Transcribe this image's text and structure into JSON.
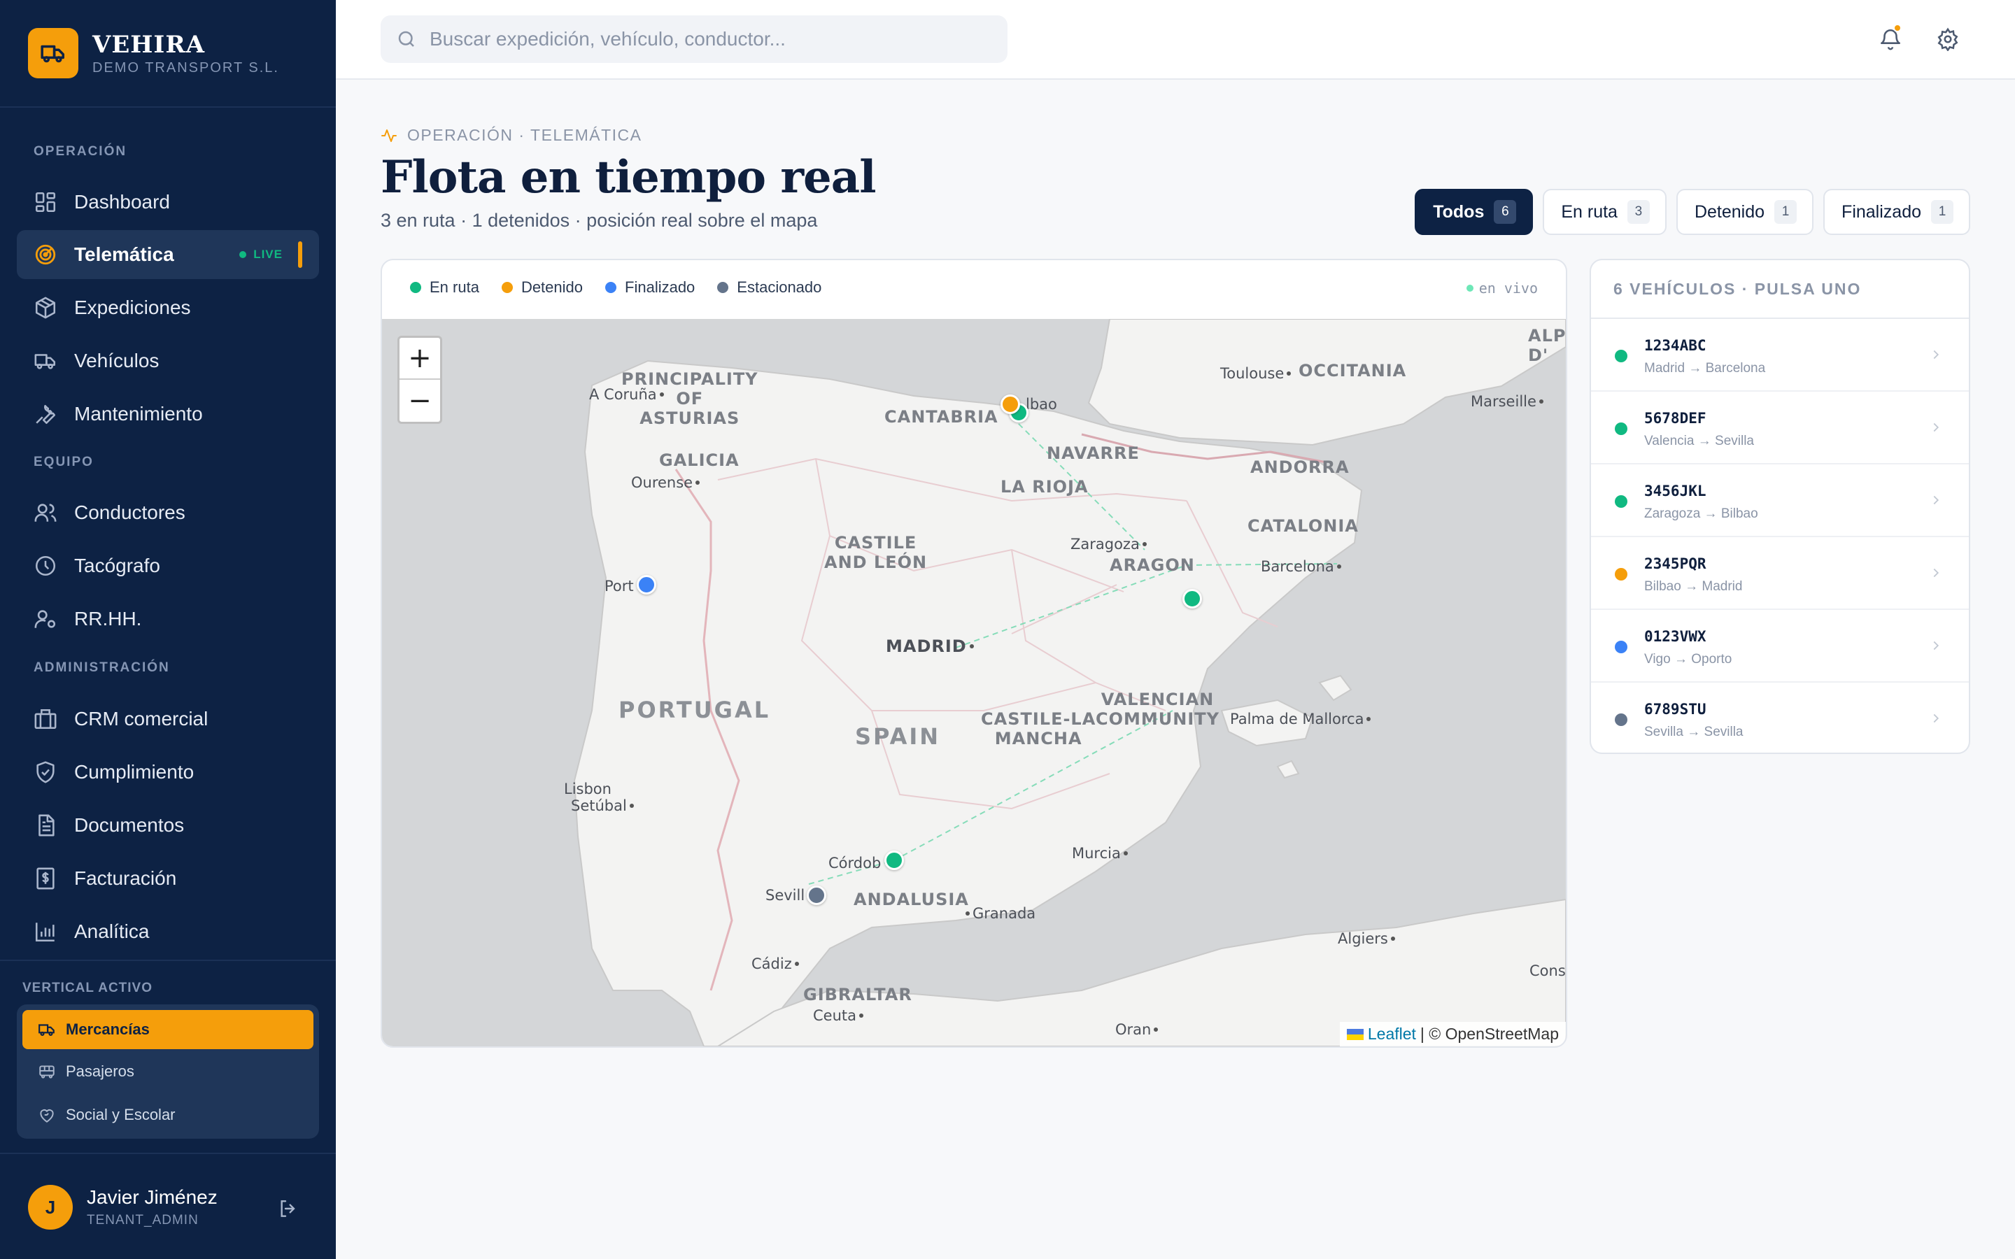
{
  "brand": {
    "name": "VEHIRA",
    "subtitle": "DEMO TRANSPORT S.L."
  },
  "sidebar": {
    "sections": {
      "operacion": "OPERACIÓN",
      "equipo": "EQUIPO",
      "administracion": "ADMINISTRACIÓN"
    },
    "items": {
      "dashboard": "Dashboard",
      "telematica": "Telemática",
      "telematica_badge": "LIVE",
      "expediciones": "Expediciones",
      "vehiculos": "Vehículos",
      "mantenimiento": "Mantenimiento",
      "conductores": "Conductores",
      "tacografo": "Tacógrafo",
      "rrhh": "RR.HH.",
      "crm": "CRM comercial",
      "cumplimiento": "Cumplimiento",
      "documentos": "Documentos",
      "facturacion": "Facturación",
      "analitica": "Analítica"
    },
    "vertical": {
      "label": "VERTICAL ACTIVO",
      "options": [
        "Mercancías",
        "Pasajeros",
        "Social y Escolar"
      ],
      "selected": "Mercancías"
    },
    "user": {
      "initial": "J",
      "name": "Javier Jiménez",
      "role": "TENANT_ADMIN"
    }
  },
  "header": {
    "search_placeholder": "Buscar expedición, vehículo, conductor...",
    "icons": [
      "bell-icon",
      "gear-icon"
    ],
    "has_notification": true
  },
  "page": {
    "eyebrow": "OPERACIÓN · TELEMÁTICA",
    "title": "Flota en tiempo real",
    "subtitle": "3 en ruta · 1 detenidos · posición real sobre el mapa"
  },
  "filters": [
    {
      "label": "Todos",
      "count": "6",
      "active": true
    },
    {
      "label": "En ruta",
      "count": "3"
    },
    {
      "label": "Detenido",
      "count": "1"
    },
    {
      "label": "Finalizado",
      "count": "1"
    }
  ],
  "legend": [
    {
      "label": "En ruta",
      "color": "#10b981"
    },
    {
      "label": "Detenido",
      "color": "#f59e0b"
    },
    {
      "label": "Finalizado",
      "color": "#3b82f6"
    },
    {
      "label": "Estacionado",
      "color": "#64748b"
    }
  ],
  "live_label": "en vivo",
  "map": {
    "zoom_in": "+",
    "zoom_out": "−",
    "attribution_link": "Leaflet",
    "attribution_text": "| © OpenStreetMap",
    "regions": {
      "asturias": "PRINCIPALITY\nOF\nASTURIAS",
      "cantabria": "CANTABRIA",
      "galicia": "GALICIA",
      "navarre": "NAVARRE",
      "rioja": "LA RIOJA",
      "castile_leon": "CASTILE\nAND LEÓN",
      "aragon": "ARAGON",
      "catalonia": "CATALONIA",
      "andorra": "ANDORRA",
      "occitania": "OCCITANIA",
      "alpes": "ALPI\nD'",
      "castile_mancha": "CASTILE-LA\nMANCHA",
      "valencia": "VALENCIAN\nCOMMUNITY",
      "andalusia": "ANDALUSIA",
      "gibraltar": "GIBRALTAR"
    },
    "countries": {
      "portugal": "PORTUGAL",
      "spain": "SPAIN"
    },
    "cities": {
      "acoruna": "A Coruña",
      "ourense": "Ourense",
      "porto": "Port",
      "bilbao": "lbao",
      "toulouse": "Toulouse",
      "marseille": "Marseille",
      "zaragoza": "Zaragoza",
      "barcelona": "Barcelona",
      "madrid": "MADRID",
      "lisbon": "Lisbon",
      "setubal": "Setúbal",
      "palma": "Palma de Mallorca",
      "cordoba": "Córdob",
      "murcia": "Murcia",
      "sevilla": "Sevill",
      "granada": "Granada",
      "cadiz": "Cádiz",
      "ceuta": "Ceuta",
      "algiers": "Algiers",
      "oran": "Oran",
      "const": "Const"
    }
  },
  "vehicle_list": {
    "title": "6 VEHÍCULOS · PULSA UNO",
    "vehicles": [
      {
        "plate": "1234ABC",
        "route": "Madrid → Barcelona",
        "status": "en_ruta",
        "color": "#10b981"
      },
      {
        "plate": "5678DEF",
        "route": "Valencia → Sevilla",
        "status": "en_ruta",
        "color": "#10b981"
      },
      {
        "plate": "3456JKL",
        "route": "Zaragoza → Bilbao",
        "status": "en_ruta",
        "color": "#10b981"
      },
      {
        "plate": "2345PQR",
        "route": "Bilbao → Madrid",
        "status": "detenido",
        "color": "#f59e0b"
      },
      {
        "plate": "0123VWX",
        "route": "Vigo → Oporto",
        "status": "finalizado",
        "color": "#3b82f6"
      },
      {
        "plate": "6789STU",
        "route": "Sevilla → Sevilla",
        "status": "estacionado",
        "color": "#64748b"
      }
    ]
  },
  "colors": {
    "sidebar_bg": "#0d2244",
    "accent": "#f59e0b",
    "en_ruta": "#10b981",
    "detenido": "#f59e0b",
    "finalizado": "#3b82f6",
    "estacionado": "#64748b"
  }
}
